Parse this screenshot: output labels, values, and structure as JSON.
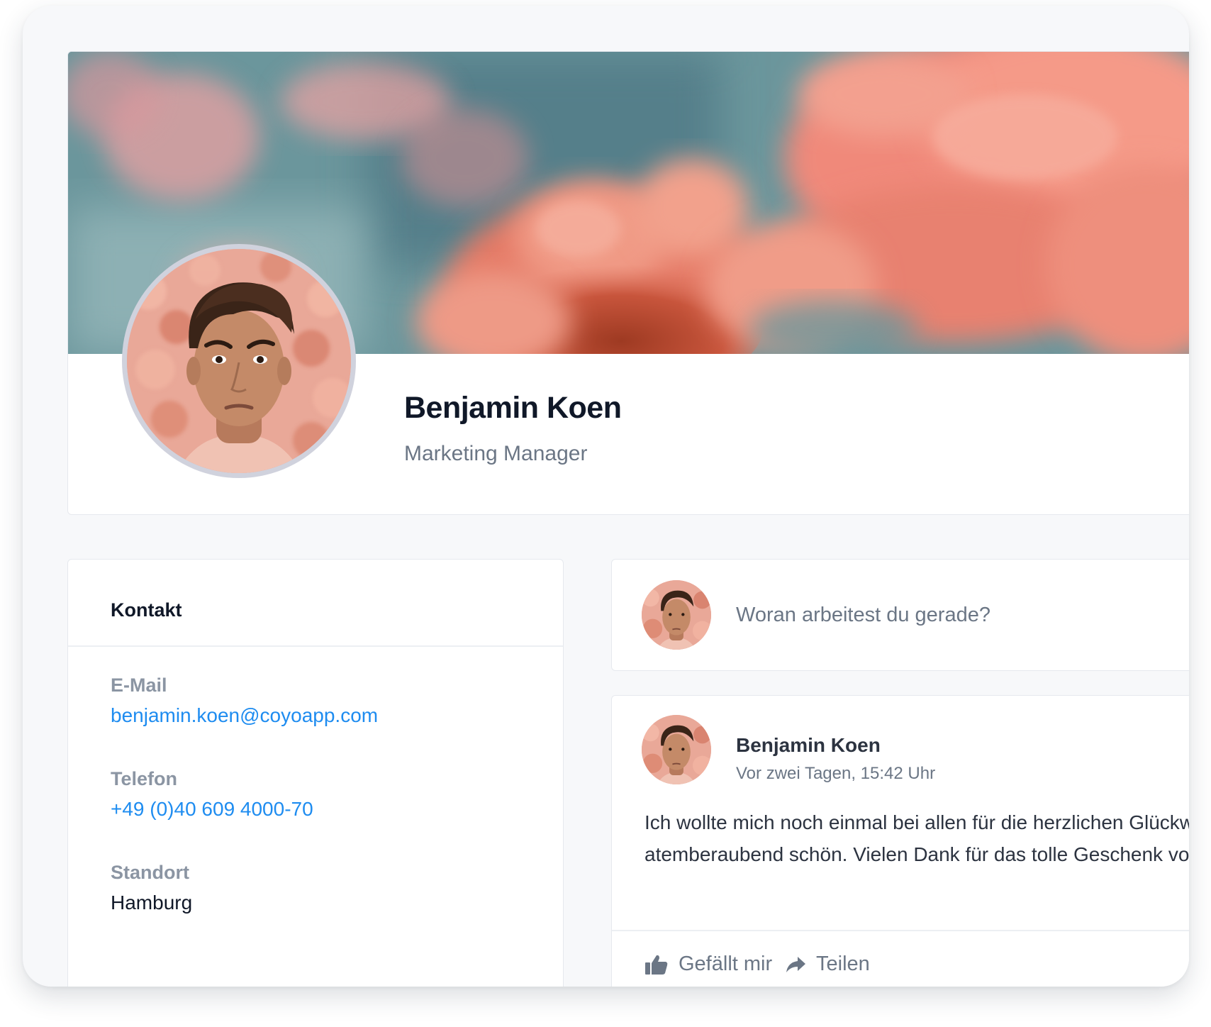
{
  "profile": {
    "name": "Benjamin Koen",
    "role": "Marketing Manager"
  },
  "contact": {
    "title": "Kontakt",
    "fields": [
      {
        "label": "E-Mail",
        "value": "benjamin.koen@coyoapp.com",
        "type": "link"
      },
      {
        "label": "Telefon",
        "value": "+49 (0)40 609 4000-70",
        "type": "link"
      },
      {
        "label": "Standort",
        "value": "Hamburg",
        "type": "text"
      }
    ]
  },
  "composer": {
    "placeholder": "Woran arbeitest du gerade?"
  },
  "post": {
    "author": "Benjamin Koen",
    "time": "Vor zwei Tagen, 15:42 Uhr",
    "lines": [
      "Ich wollte mich noch einmal bei allen für die herzlichen Glückw",
      "atemberaubend schön. Vielen Dank für das tolle Geschenk von"
    ],
    "actions": {
      "like": "Gefällt mir",
      "share": "Teilen"
    }
  },
  "colors": {
    "link": "#1e8cf0",
    "heading": "#101828",
    "muted": "#6b7685",
    "label": "#8b95a3"
  },
  "icons": {
    "like": "thumbs-up-icon",
    "share": "share-arrow-icon"
  }
}
